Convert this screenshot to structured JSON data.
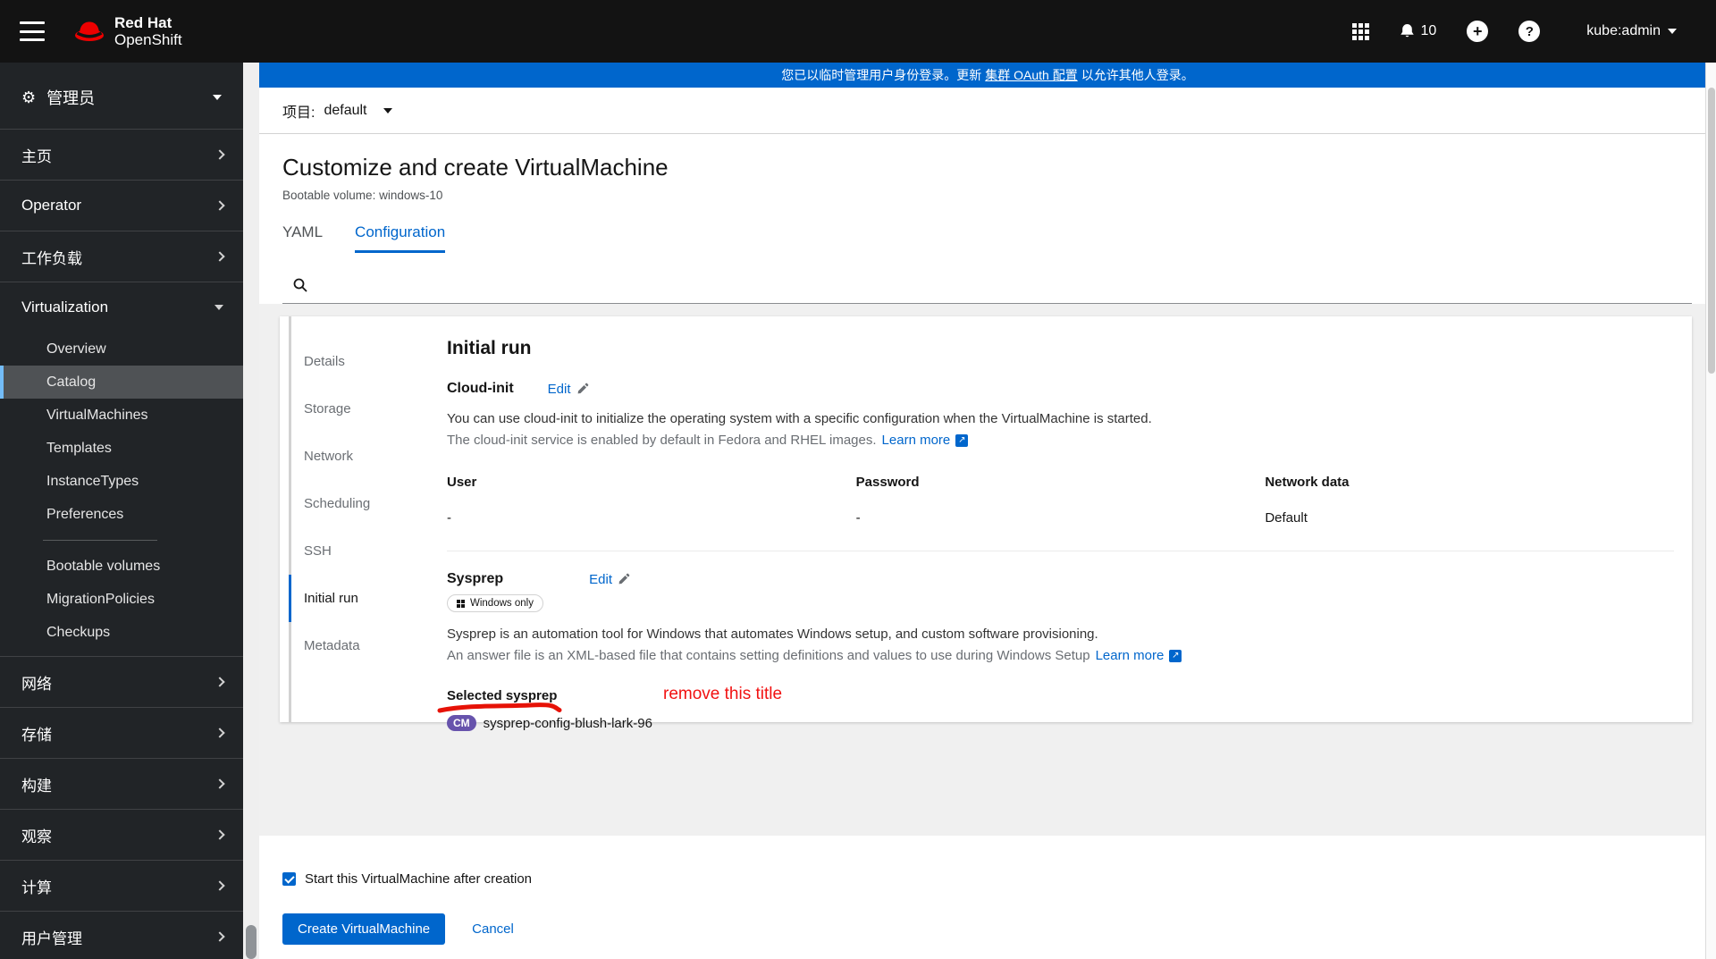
{
  "masthead": {
    "brand_line1": "Red Hat",
    "brand_line2": "OpenShift",
    "notification_count": "10",
    "user": "kube:admin"
  },
  "banner": {
    "text_before": "您已以临时管理用户身份登录。更新",
    "link_text": "集群 OAuth 配置",
    "text_after": "以允许其他人登录。"
  },
  "sidebar": {
    "perspective": "管理员",
    "top": [
      "主页",
      "Operator",
      "工作负载"
    ],
    "virtualization_label": "Virtualization",
    "virt_children": [
      "Overview",
      "Catalog",
      "VirtualMachines",
      "Templates",
      "InstanceTypes",
      "Preferences"
    ],
    "virt_children2": [
      "Bootable volumes",
      "MigrationPolicies",
      "Checkups"
    ],
    "bottom": [
      "网络",
      "存储",
      "构建",
      "观察",
      "计算",
      "用户管理"
    ]
  },
  "page": {
    "project_label": "项目:",
    "project_value": "default",
    "title": "Customize and create VirtualMachine",
    "subtitle": "Bootable volume: windows-10",
    "tab_yaml": "YAML",
    "tab_configuration": "Configuration"
  },
  "config_nav": [
    "Details",
    "Storage",
    "Network",
    "Scheduling",
    "SSH",
    "Initial run",
    "Metadata"
  ],
  "initial_run": {
    "heading": "Initial run",
    "cloud_init": {
      "title": "Cloud-init",
      "edit_label": "Edit",
      "desc1": "You can use cloud-init to initialize the operating system with a specific configuration when the VirtualMachine is started.",
      "desc2": "The cloud-init service is enabled by default in Fedora and RHEL images.",
      "learn_more": "Learn more",
      "fields": [
        {
          "label": "User",
          "value": "-"
        },
        {
          "label": "Password",
          "value": "-"
        },
        {
          "label": "Network data",
          "value": "Default"
        }
      ]
    },
    "sysprep": {
      "title": "Sysprep",
      "edit_label": "Edit",
      "os_pill": "Windows only",
      "desc1": "Sysprep is an automation tool for Windows that automates Windows setup, and custom software provisioning.",
      "desc2": "An answer file is an XML-based file that contains setting definitions and values to use during Windows Setup",
      "learn_more": "Learn more",
      "selected_label": "Selected sysprep",
      "badge": "CM",
      "config_name": "sysprep-config-blush-lark-96"
    }
  },
  "annotation": {
    "note": "remove this title"
  },
  "footer": {
    "start_checkbox": "Start this VirtualMachine after creation",
    "create": "Create VirtualMachine",
    "cancel": "Cancel"
  },
  "colors": {
    "accent": "#0066cc",
    "banner": "#0066cc",
    "masthead": "#131313",
    "sidebar": "#212427",
    "active_nav_border": "#73bcf7",
    "cm_badge": "#6753ac",
    "annotation_red": "#f11212"
  }
}
